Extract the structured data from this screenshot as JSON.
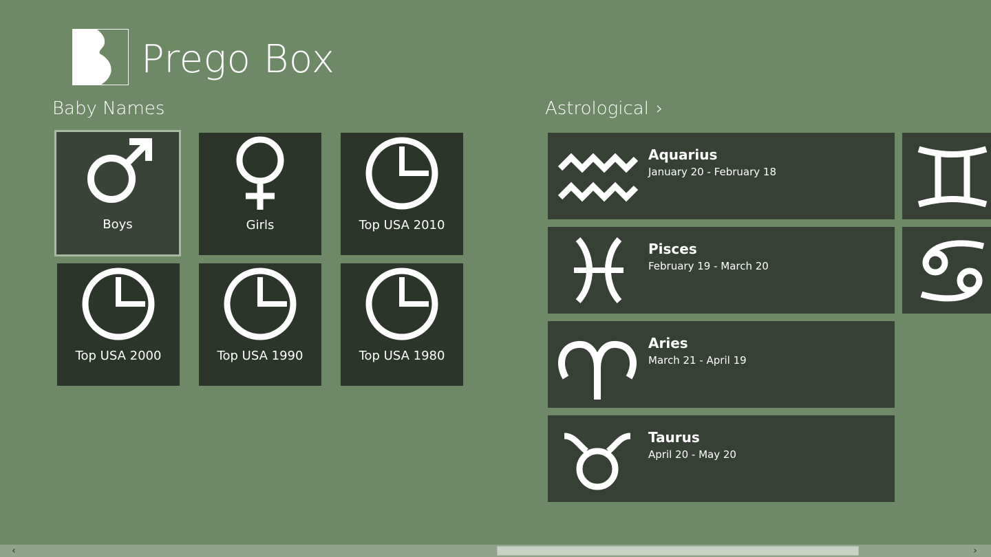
{
  "app": {
    "title": "Prego Box"
  },
  "sections": {
    "baby_names": {
      "header": "Baby Names"
    },
    "astrological": {
      "header": "Astrological",
      "chevron": "›"
    }
  },
  "baby_tiles": [
    {
      "label": "Boys",
      "icon": "male-symbol-icon",
      "selected": true
    },
    {
      "label": "Girls",
      "icon": "female-symbol-icon"
    },
    {
      "label": "Top USA 2010",
      "icon": "clock-icon"
    },
    {
      "label": "Top USA 2000",
      "icon": "clock-icon"
    },
    {
      "label": "Top USA 1990",
      "icon": "clock-icon"
    },
    {
      "label": "Top USA 1980",
      "icon": "clock-icon"
    }
  ],
  "astro_tiles": [
    {
      "name": "Aquarius",
      "dates": "January 20 - February 18",
      "icon": "aquarius-icon"
    },
    {
      "name": "Pisces",
      "dates": "February 19 - March 20",
      "icon": "pisces-icon"
    },
    {
      "name": "Aries",
      "dates": "March 21 - April 19",
      "icon": "aries-icon"
    },
    {
      "name": "Taurus",
      "dates": "April 20 - May 20",
      "icon": "taurus-icon"
    }
  ],
  "partial_tiles": [
    {
      "icon": "gemini-icon"
    },
    {
      "icon": "cancer-icon"
    }
  ],
  "scrollbar": {
    "left_arrow": "‹",
    "right_arrow": "›"
  },
  "colors": {
    "background": "#6e8965",
    "tile": "#2b3529",
    "astro_tile": "#364034",
    "selected_border": "#a8b9a1"
  }
}
